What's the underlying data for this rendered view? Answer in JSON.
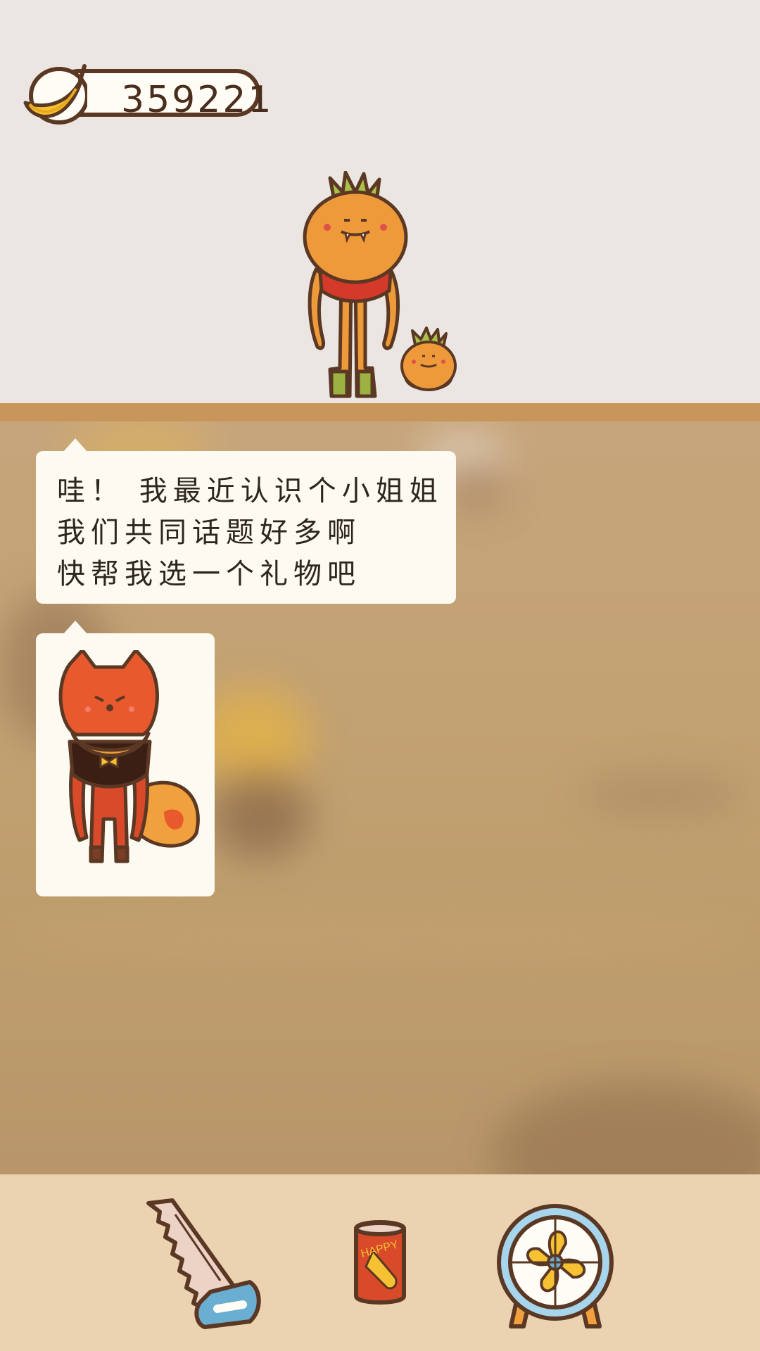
{
  "currency": {
    "icon": "banana-icon",
    "value": "359221"
  },
  "characters": {
    "main": "pumpkin-character",
    "pet": "small-pumpkin-character",
    "shown": "fox-character"
  },
  "dialog": {
    "lines": [
      "哇！ 我最近认识个小姐姐",
      "我们共同话题好多啊",
      "快帮我选一个礼物吧"
    ]
  },
  "toolbar": {
    "items": [
      {
        "icon": "saw-icon"
      },
      {
        "icon": "soda-can-icon",
        "label": "HAPPY"
      },
      {
        "icon": "fan-icon"
      }
    ]
  },
  "colors": {
    "background": "#ebe6e2",
    "shelf": "#c8955a",
    "toolbar": "#ebd3b2",
    "outline": "#5b3823"
  }
}
